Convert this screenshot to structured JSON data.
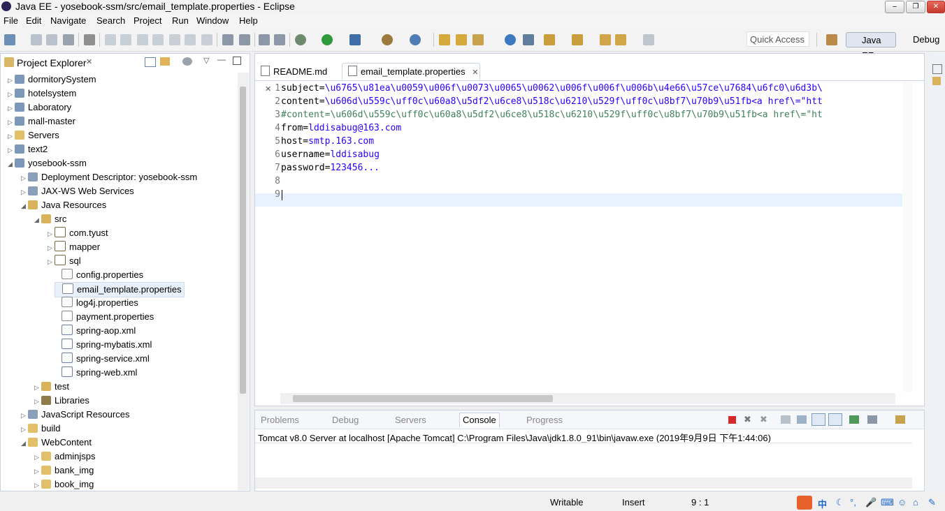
{
  "window": {
    "title": "Java EE - yosebook-ssm/src/email_template.properties - Eclipse"
  },
  "menu": [
    "File",
    "Edit",
    "Navigate",
    "Search",
    "Project",
    "Run",
    "Window",
    "Help"
  ],
  "toolbar": {
    "quick_access": "Quick Access",
    "perspective_javaee": "Java EE",
    "perspective_debug": "Debug"
  },
  "explorer": {
    "title": "Project Explorer",
    "items": [
      {
        "label": "dormitorySystem"
      },
      {
        "label": "hotelsystem"
      },
      {
        "label": "Laboratory"
      },
      {
        "label": "mall-master"
      },
      {
        "label": "Servers"
      },
      {
        "label": "text2"
      },
      {
        "label": "yosebook-ssm"
      },
      {
        "label": "Deployment Descriptor: yosebook-ssm"
      },
      {
        "label": "JAX-WS Web Services"
      },
      {
        "label": "Java Resources"
      },
      {
        "label": "src"
      },
      {
        "label": "com.tyust"
      },
      {
        "label": "mapper"
      },
      {
        "label": "sql"
      },
      {
        "label": "config.properties"
      },
      {
        "label": "email_template.properties"
      },
      {
        "label": "log4j.properties"
      },
      {
        "label": "payment.properties"
      },
      {
        "label": "spring-aop.xml"
      },
      {
        "label": "spring-mybatis.xml"
      },
      {
        "label": "spring-service.xml"
      },
      {
        "label": "spring-web.xml"
      },
      {
        "label": "test"
      },
      {
        "label": "Libraries"
      },
      {
        "label": "JavaScript Resources"
      },
      {
        "label": "build"
      },
      {
        "label": "WebContent"
      },
      {
        "label": "adminjsps"
      },
      {
        "label": "bank_img"
      },
      {
        "label": "book_img"
      }
    ]
  },
  "editor": {
    "tabs": [
      {
        "label": "README.md"
      },
      {
        "label": "email_template.properties"
      }
    ],
    "lines": [
      {
        "num": "1",
        "key": "subject=",
        "val": "\\u6765\\u81ea\\u0059\\u006f\\u0073\\u0065\\u0062\\u006f\\u006f\\u006b\\u4e66\\u57ce\\u7684\\u6fc0\\u6d3b\\"
      },
      {
        "num": "2",
        "key": "content=",
        "val": "\\u606d\\u559c\\uff0c\\u60a8\\u5df2\\u6ce8\\u518c\\u6210\\u529f\\uff0c\\u8bf7\\u70b9\\u51fb<a href\\=\"htt"
      },
      {
        "num": "3",
        "comment": "#content=\\u606d\\u559c\\uff0c\\u60a8\\u5df2\\u6ce8\\u518c\\u6210\\u529f\\uff0c\\u8bf7\\u70b9\\u51fb<a href\\=\"ht"
      },
      {
        "num": "4",
        "key": "from=",
        "val": "lddisabug@163.com"
      },
      {
        "num": "5",
        "key": "host=",
        "val": "smtp.163.com"
      },
      {
        "num": "6",
        "key": "username=",
        "val": "lddisabug"
      },
      {
        "num": "7",
        "key": "password=",
        "val": "123456..."
      },
      {
        "num": "8",
        "key": "",
        "val": ""
      },
      {
        "num": "9",
        "key": "",
        "val": ""
      }
    ]
  },
  "console": {
    "tabs": [
      "Problems",
      "Debug",
      "Servers",
      "Console",
      "Progress"
    ],
    "description": "Tomcat v8.0 Server at localhost [Apache Tomcat] C:\\Program Files\\Java\\jdk1.8.0_91\\bin\\javaw.exe (2019年9月9日 下午1:44:06)"
  },
  "status": {
    "writable": "Writable",
    "insert": "Insert",
    "position": "9 : 1"
  },
  "colors": {
    "accent": "#2a00ff",
    "comment": "#3f7f5f",
    "selection": "#e8f0fb"
  }
}
